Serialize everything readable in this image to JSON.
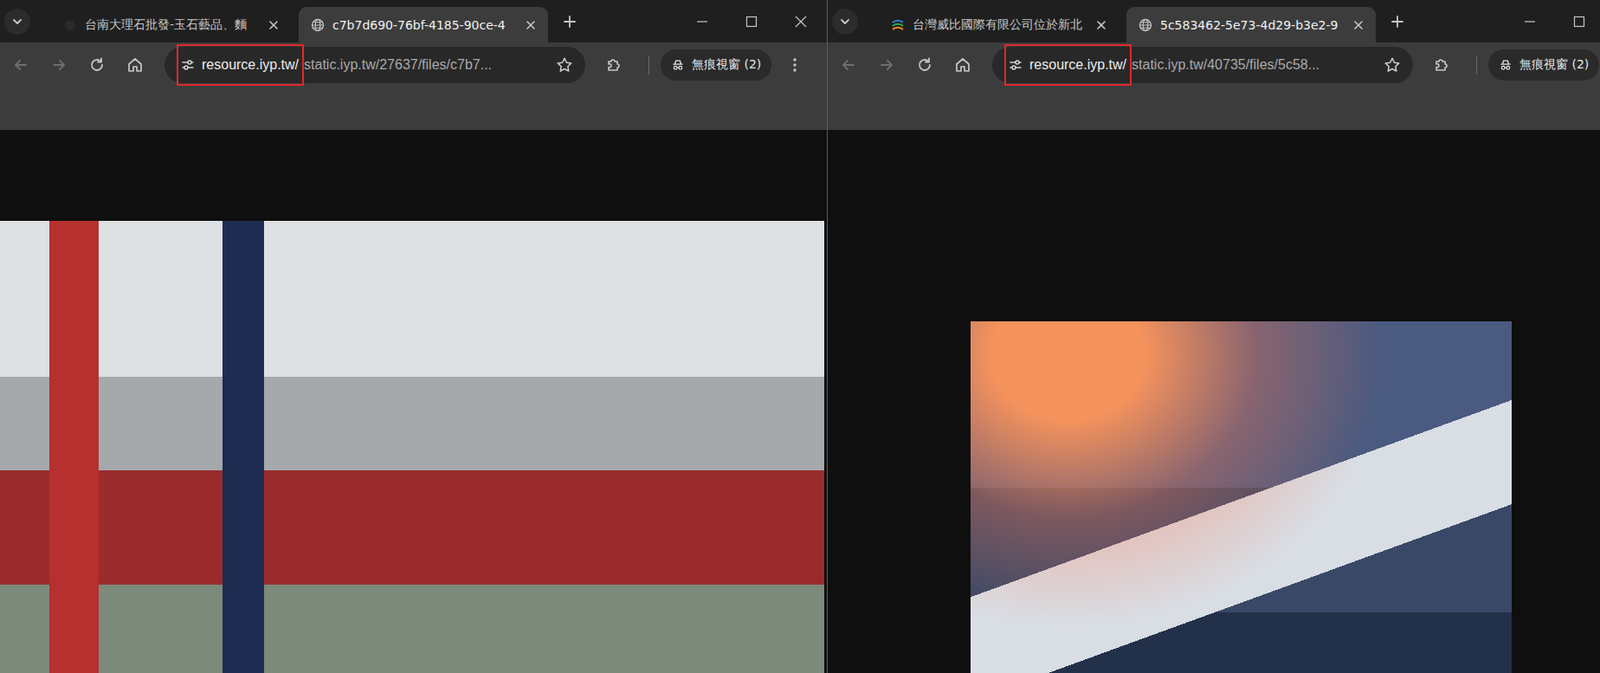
{
  "windows": [
    {
      "tabs": [
        {
          "label": "台南大理石批發-玉石藝品、麵",
          "selected": false,
          "kind": "blank"
        },
        {
          "label": "c7b7d690-76bf-4185-90ce-4",
          "selected": true,
          "kind": "globe"
        }
      ],
      "nav": {
        "back_disabled": true,
        "forward_disabled": true
      },
      "address": {
        "host": "resource.iyp.tw/",
        "path": "static.iyp.tw/27637/files/c7b7...",
        "highlighted": true
      },
      "profile": {
        "label": "無痕視窗 (2)"
      },
      "photo": {
        "kind": "storefront"
      }
    },
    {
      "tabs": [
        {
          "label": "台灣威比國際有限公司位於新北",
          "selected": false,
          "kind": "logo"
        },
        {
          "label": "5c583462-5e73-4d29-b3e2-9",
          "selected": true,
          "kind": "globe"
        }
      ],
      "nav": {
        "back_disabled": true,
        "forward_disabled": true
      },
      "address": {
        "host": "resource.iyp.tw/",
        "path": "static.iyp.tw/40735/files/5c58...",
        "highlighted": true
      },
      "profile": {
        "label": "無痕視窗 (2)"
      },
      "photo": {
        "kind": "machinery"
      }
    }
  ]
}
